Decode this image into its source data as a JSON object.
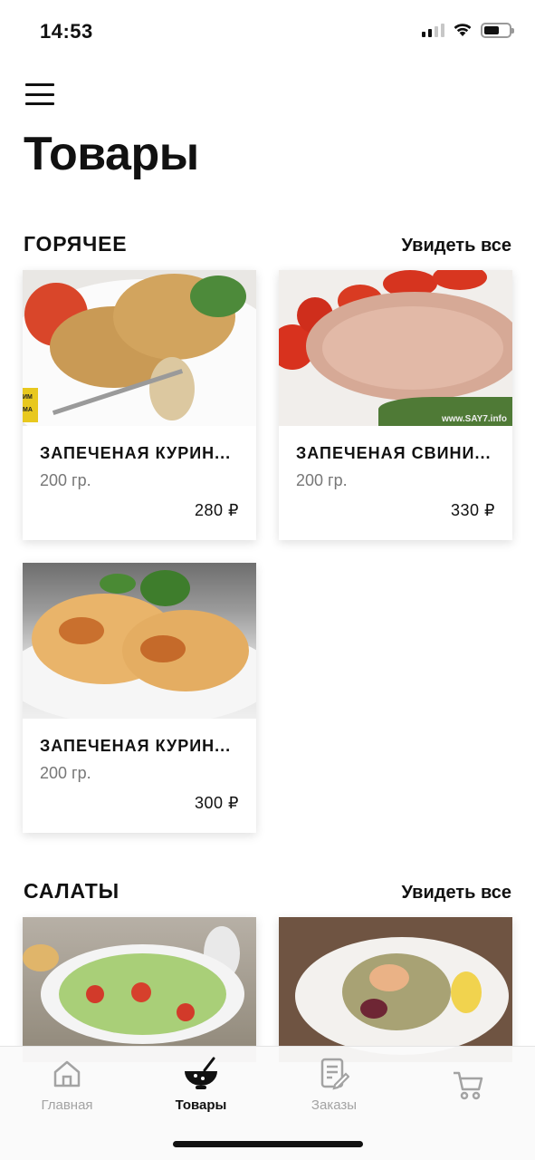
{
  "status": {
    "time": "14:53"
  },
  "page": {
    "title": "Товары"
  },
  "sections": [
    {
      "title": "ГОРЯЧЕЕ",
      "see_all": "Увидеть все",
      "items": [
        {
          "name": "ЗАПЕЧЕНАЯ КУРИН...",
          "weight": "200 гр.",
          "price": "280 ₽"
        },
        {
          "name": "ЗАПЕЧЕНАЯ СВИНИ...",
          "weight": "200 гр.",
          "price": "330 ₽"
        },
        {
          "name": "ЗАПЕЧЕНАЯ КУРИН...",
          "weight": "200 гр.",
          "price": "300 ₽"
        }
      ]
    },
    {
      "title": "САЛАТЫ",
      "see_all": "Увидеть все"
    }
  ],
  "watermarks": {
    "item1_logo": "ИМ МА",
    "item2_site": "www.SAY7.info"
  },
  "tabbar": {
    "tabs": [
      {
        "label": "Главная",
        "icon": "home-icon"
      },
      {
        "label": "Товары",
        "icon": "bowl-icon"
      },
      {
        "label": "Заказы",
        "icon": "orders-icon"
      },
      {
        "label": "",
        "icon": "cart-icon"
      }
    ],
    "active_color": "#111111",
    "inactive_color": "#a3a3a3"
  }
}
